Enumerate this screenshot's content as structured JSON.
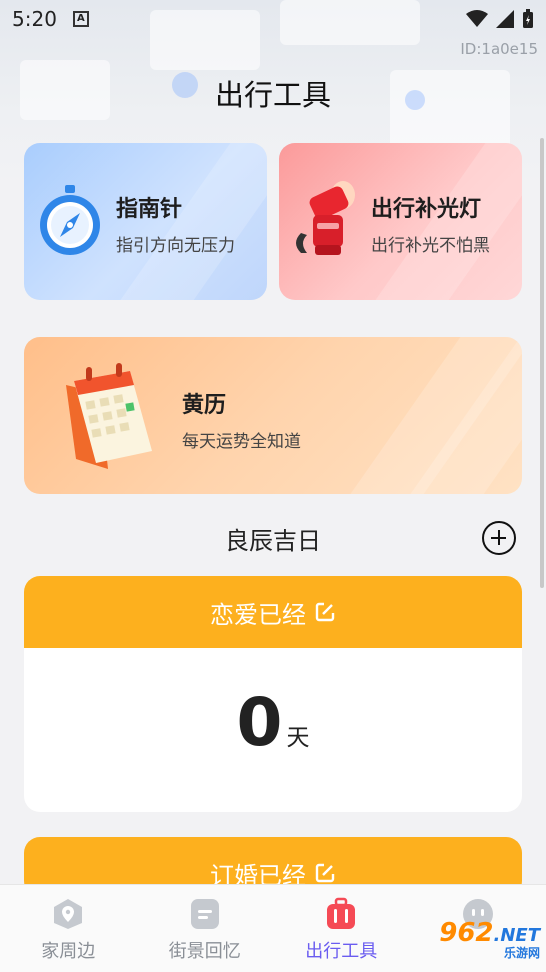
{
  "status_bar": {
    "time": "5:20",
    "notification_icon": "A"
  },
  "id_label": "ID:1a0e15",
  "page_title": "出行工具",
  "cards": {
    "compass": {
      "title": "指南针",
      "subtitle": "指引方向无压力",
      "icon": "compass-icon"
    },
    "light": {
      "title": "出行补光灯",
      "subtitle": "出行补光不怕黑",
      "icon": "flashlight-icon"
    },
    "almanac": {
      "title": "黄历",
      "subtitle": "每天运势全知道",
      "icon": "calendar-icon"
    }
  },
  "section": {
    "title": "良辰吉日"
  },
  "counters": [
    {
      "title": "恋爱已经",
      "value": "0",
      "unit": "天"
    },
    {
      "title": "订婚已经"
    }
  ],
  "colors": {
    "accent": "#fdb01e",
    "active_tab": "#6a5cf0"
  },
  "nav": [
    {
      "label": "家周边",
      "icon": "location-icon"
    },
    {
      "label": "街景回忆",
      "icon": "document-icon"
    },
    {
      "label": "出行工具",
      "icon": "suitcase-icon",
      "active": true
    },
    {
      "label": "",
      "icon": "profile-icon"
    }
  ],
  "watermark": {
    "main": "962",
    "suffix": ".NET",
    "sub": "乐游网"
  }
}
